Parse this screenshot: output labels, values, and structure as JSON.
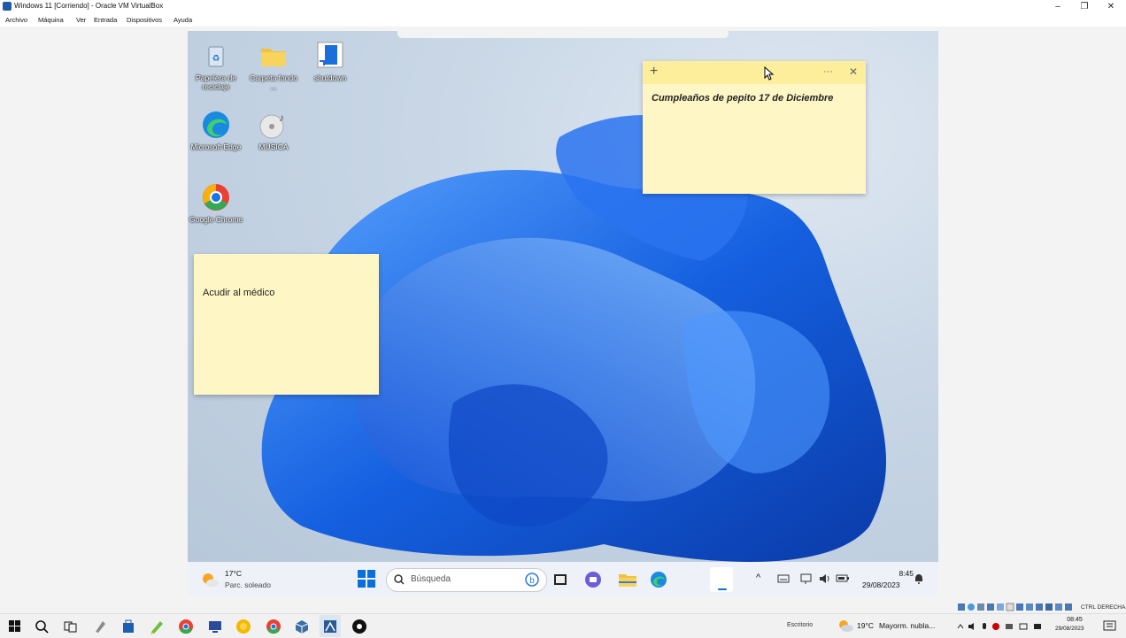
{
  "host": {
    "title": "Windows 11 [Corriendo] - Oracle VM VirtualBox",
    "window_controls": [
      "–",
      "❐",
      "✕"
    ],
    "menu": [
      "Archivo",
      "Máquina",
      "Ver",
      "Entrada",
      "Dispositivos",
      "Ayuda"
    ],
    "status_right": "CTRL DERECHA",
    "taskbar": {
      "desktop_label": "Escritorio",
      "weather_temp": "19°C",
      "weather_desc": "Mayorm. nubla...",
      "time": "08:45",
      "date": "29/08/2023"
    }
  },
  "desktop": {
    "icons": [
      {
        "label": "Papelera de reciclaje",
        "icon": "recycle-bin-icon"
      },
      {
        "label": "Carpeta fondo ...",
        "icon": "folder-icon"
      },
      {
        "label": "shutdown",
        "icon": "shortcut-icon"
      },
      {
        "label": "Microsoft Edge",
        "icon": "edge-icon"
      },
      {
        "label": "MÚSICA",
        "icon": "music-icon"
      },
      {
        "label": "Google Chrome",
        "icon": "chrome-icon"
      }
    ]
  },
  "sticky_notes": [
    {
      "text": "Cumpleaños de pepito 17 de Diciembre",
      "add_label": "+",
      "more_label": "···",
      "close_label": "✕"
    },
    {
      "text": "Acudir al médico"
    }
  ],
  "vm_taskbar": {
    "weather_temp": "17°C",
    "weather_desc": "Parc. soleado",
    "search_placeholder": "Búsqueda",
    "time": "8:45",
    "date": "29/08/2023",
    "tray_chevron": "^"
  },
  "colors": {
    "bloom": "#1560e0",
    "sticky": "#fef7c5",
    "sticky_header": "#fcee9b"
  }
}
